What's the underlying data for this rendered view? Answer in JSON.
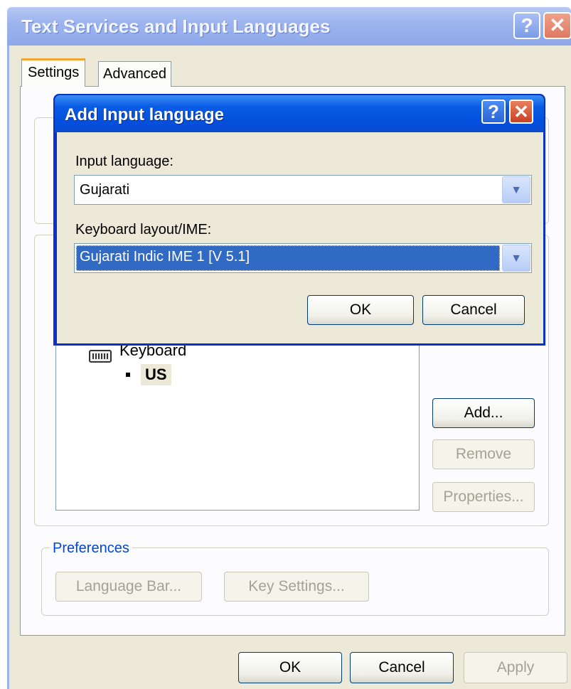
{
  "window": {
    "title": "Text Services and Input Languages",
    "help_glyph": "?",
    "close_glyph": "✕"
  },
  "tabs": [
    {
      "label": "Settings",
      "active": true
    },
    {
      "label": "Advanced",
      "active": false
    }
  ],
  "installed_services": {
    "items": [
      {
        "label": "Keyboard",
        "icon": "keyboard-icon"
      },
      {
        "label": "US"
      }
    ],
    "buttons": {
      "add": "Add...",
      "remove": "Remove",
      "properties": "Properties..."
    }
  },
  "preferences": {
    "legend": "Preferences",
    "language_bar": "Language Bar...",
    "key_settings": "Key Settings..."
  },
  "footer": {
    "ok": "OK",
    "cancel": "Cancel",
    "apply": "Apply"
  },
  "modal": {
    "title": "Add Input language",
    "help_glyph": "?",
    "close_glyph": "✕",
    "input_language_label": "Input language:",
    "input_language_value": "Gujarati",
    "layout_label": "Keyboard layout/IME:",
    "layout_value": "Gujarati Indic IME 1 [V 5.1]",
    "ok": "OK",
    "cancel": "Cancel",
    "dropdown_glyph": "▼"
  },
  "colors": {
    "modal_title_blue": "#0a5ce5",
    "selection_blue": "#316ac5",
    "window_face": "#ece9d8",
    "preferences_legend": "#0046d5"
  }
}
